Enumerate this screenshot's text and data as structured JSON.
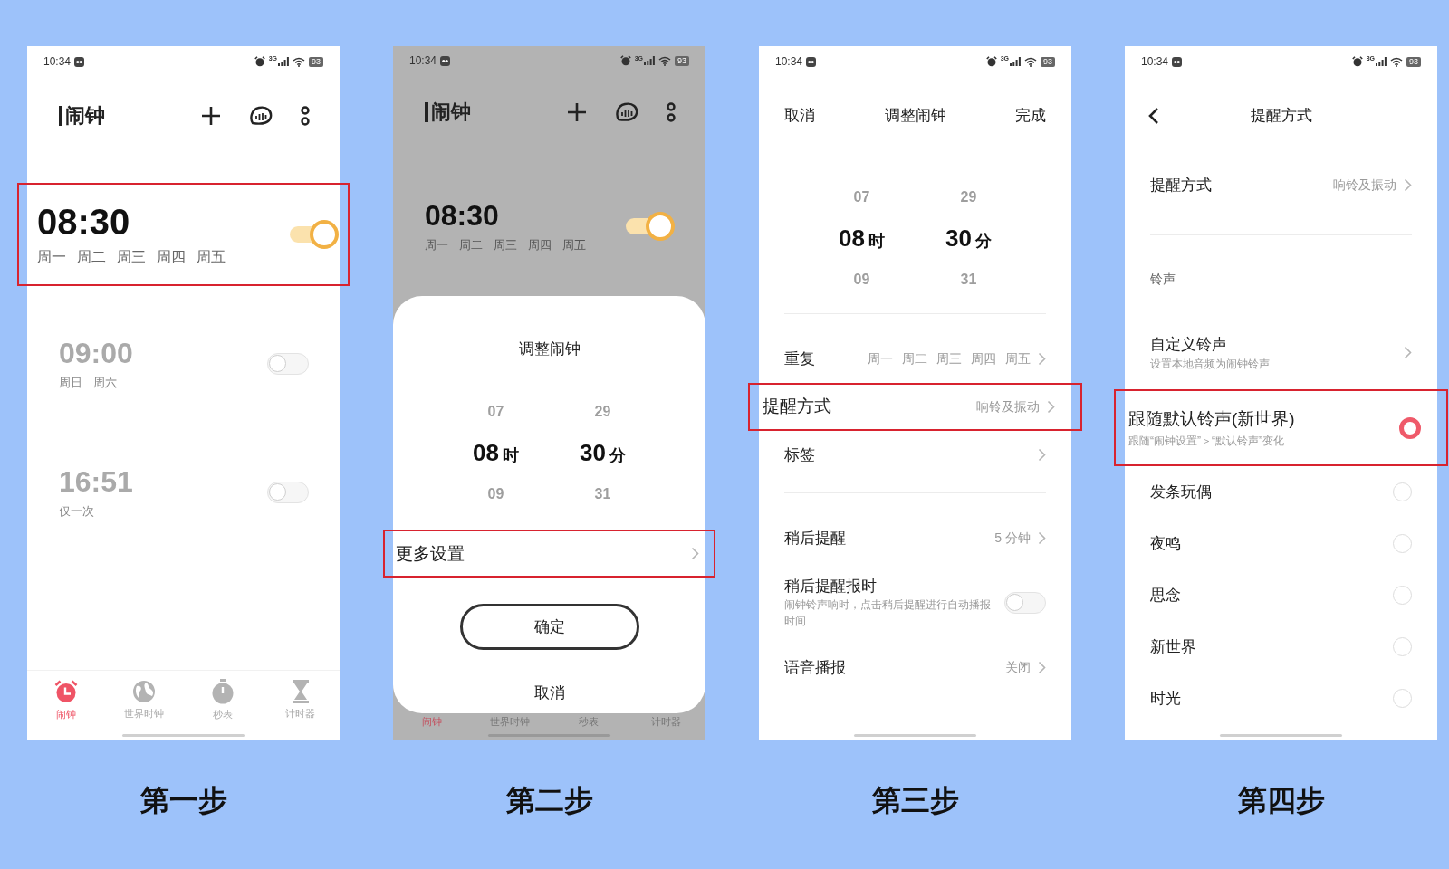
{
  "panels": [
    {
      "kind": "alarm_list",
      "caption": "第一步",
      "status_bar": {
        "time": "10:34",
        "network": "3G",
        "battery": "93"
      },
      "title": "闹钟",
      "alarms": [
        {
          "time": "08:30",
          "days": [
            "周一",
            "周二",
            "周三",
            "周四",
            "周五"
          ],
          "on": true,
          "highlighted": true
        },
        {
          "time": "09:00",
          "days": [
            "周日",
            "周六"
          ],
          "on": false,
          "highlighted": false
        },
        {
          "time": "16:51",
          "days": [
            "仅一次"
          ],
          "on": false,
          "highlighted": false
        }
      ],
      "tabs": [
        {
          "label": "闹钟",
          "selected": true
        },
        {
          "label": "世界时钟",
          "selected": false
        },
        {
          "label": "秒表",
          "selected": false
        },
        {
          "label": "计时器",
          "selected": false
        }
      ]
    },
    {
      "kind": "adjust_dialog",
      "caption": "第二步",
      "status_bar": {
        "time": "10:34",
        "network": "3G",
        "battery": "93"
      },
      "title": "闹钟",
      "alarms": [
        {
          "time": "08:30",
          "days": [
            "周一",
            "周二",
            "周三",
            "周四",
            "周五"
          ],
          "on": true,
          "highlighted": false
        }
      ],
      "dialog": {
        "title": "调整闹钟",
        "picker": {
          "hour_prev": "07",
          "hour": "08",
          "hour_unit": "时",
          "hour_next": "09",
          "minute_prev": "29",
          "minute": "30",
          "minute_unit": "分",
          "minute_next": "31"
        },
        "more": {
          "label": "更多设置",
          "highlighted": true
        },
        "confirm": "确定",
        "cancel": "取消"
      },
      "tabs": [
        {
          "label": "闹钟",
          "selected": true
        },
        {
          "label": "世界时钟",
          "selected": false
        },
        {
          "label": "秒表",
          "selected": false
        },
        {
          "label": "计时器",
          "selected": false
        }
      ]
    },
    {
      "kind": "alarm_edit",
      "caption": "第三步",
      "status_bar": {
        "time": "10:34",
        "network": "3G",
        "battery": "93"
      },
      "header": {
        "left": "取消",
        "title": "调整闹钟",
        "right": "完成"
      },
      "picker": {
        "hour_prev": "07",
        "hour": "08",
        "hour_unit": "时",
        "hour_next": "09",
        "minute_prev": "29",
        "minute": "30",
        "minute_unit": "分",
        "minute_next": "31"
      },
      "rows": [
        {
          "kind": "divider"
        },
        {
          "kind": "link",
          "label": "重复",
          "days": [
            "周一",
            "周二",
            "周三",
            "周四",
            "周五"
          ],
          "highlighted": false
        },
        {
          "kind": "link",
          "label": "提醒方式",
          "value": "响铃及振动",
          "highlighted": true
        },
        {
          "kind": "link",
          "label": "标签",
          "highlighted": false
        },
        {
          "kind": "divider"
        },
        {
          "kind": "link",
          "label": "稍后提醒",
          "value": "5 分钟",
          "highlighted": false
        },
        {
          "kind": "toggle",
          "label": "稍后提醒报时",
          "description": "闹钟铃声响时，点击稍后提醒进行自动播报时间",
          "on": false
        },
        {
          "kind": "link",
          "label": "语音播报",
          "value": "关闭",
          "highlighted": false
        }
      ]
    },
    {
      "kind": "alert_mode",
      "caption": "第四步",
      "status_bar": {
        "time": "10:34",
        "network": "3G",
        "battery": "93"
      },
      "header": {
        "title": "提醒方式"
      },
      "rows": [
        {
          "kind": "link",
          "label": "提醒方式",
          "value": "响铃及振动",
          "highlighted": false
        },
        {
          "kind": "divider"
        },
        {
          "kind": "section",
          "label": "铃声"
        },
        {
          "kind": "link",
          "label": "自定义铃声",
          "description": "设置本地音频为闹钟铃声",
          "highlighted": false
        },
        {
          "kind": "radio",
          "label": "跟随默认铃声(新世界)",
          "description": "跟随“闹钟设置”＞“默认铃声”变化",
          "selected": true,
          "highlighted": true
        },
        {
          "kind": "radio",
          "label": "发条玩偶",
          "selected": false,
          "highlighted": false
        },
        {
          "kind": "radio",
          "label": "夜鸣",
          "selected": false,
          "highlighted": false
        },
        {
          "kind": "radio",
          "label": "思念",
          "selected": false,
          "highlighted": false
        },
        {
          "kind": "radio",
          "label": "新世界",
          "selected": false,
          "highlighted": false
        },
        {
          "kind": "radio",
          "label": "时光",
          "selected": false,
          "highlighted": false
        }
      ]
    }
  ]
}
